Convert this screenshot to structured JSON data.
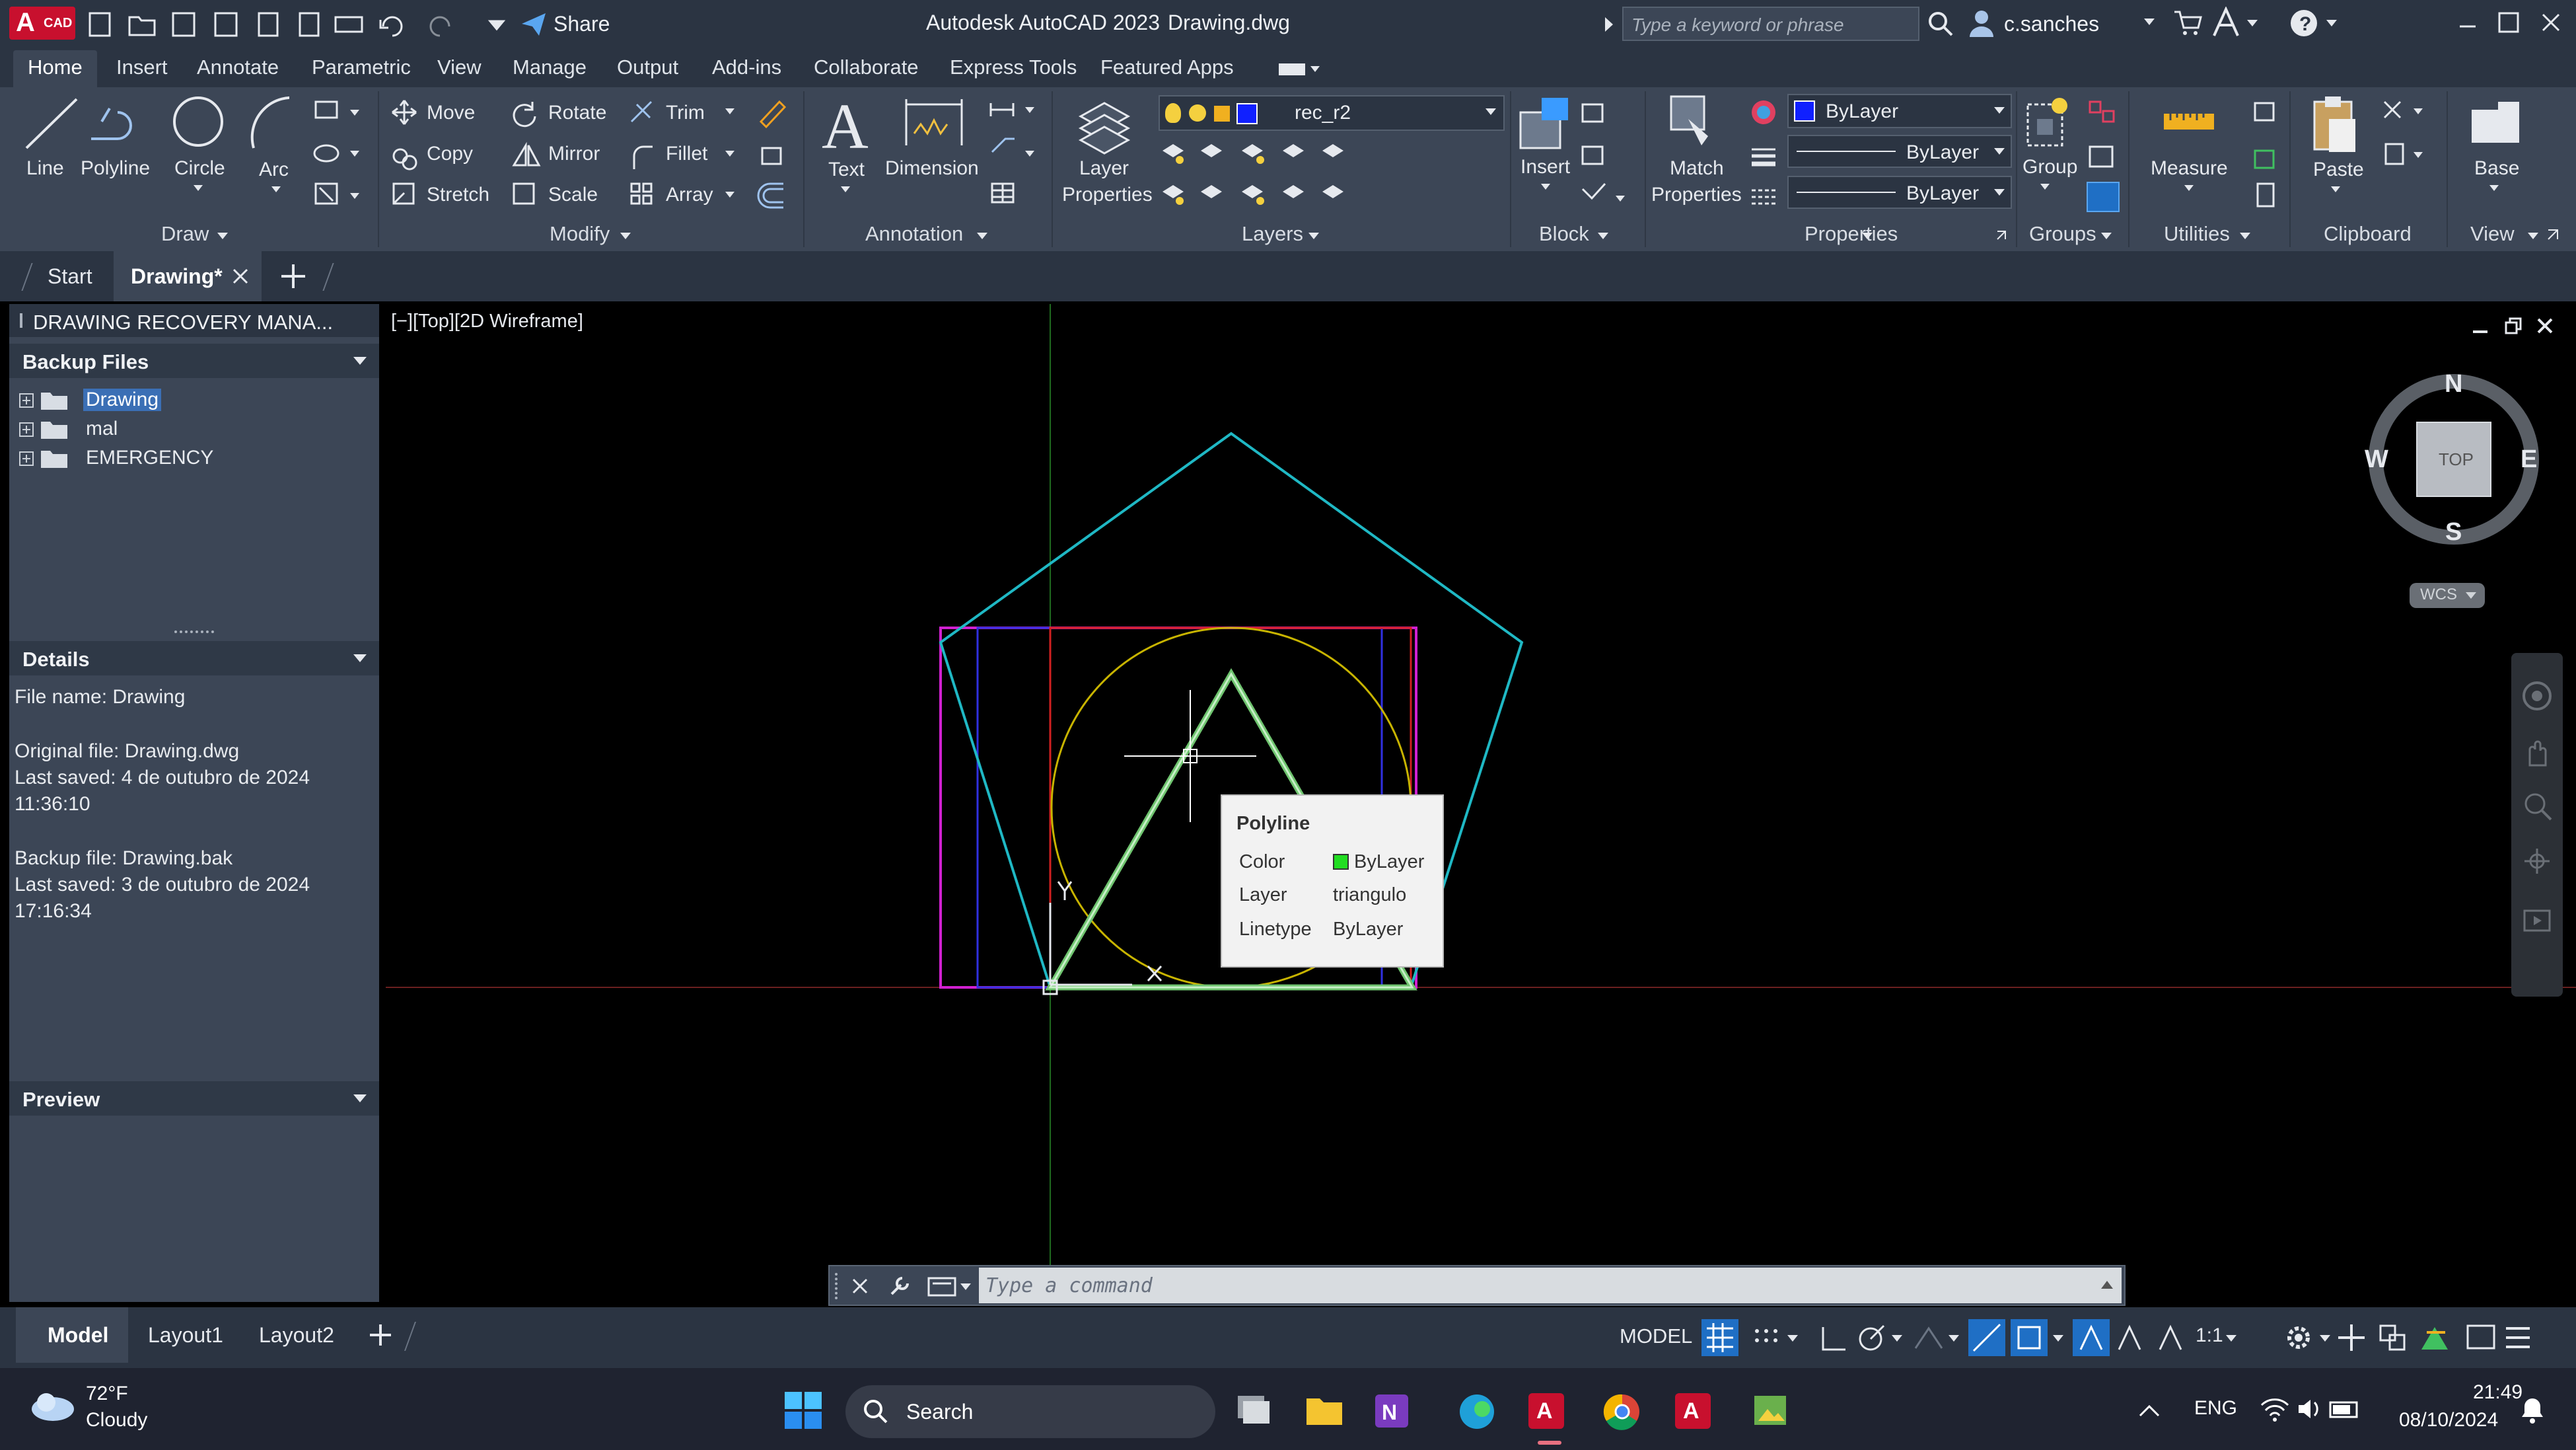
{
  "app": {
    "title": "Autodesk AutoCAD 2023",
    "file": "Drawing.dwg",
    "logo": "A",
    "logo_sub": "CAD",
    "share": "Share",
    "search_placeholder": "Type a keyword or phrase",
    "user": "c.sanches"
  },
  "ribbon_tabs": [
    "Home",
    "Insert",
    "Annotate",
    "Parametric",
    "View",
    "Manage",
    "Output",
    "Add-ins",
    "Collaborate",
    "Express Tools",
    "Featured Apps"
  ],
  "ribbon": {
    "draw": {
      "line": "Line",
      "polyline": "Polyline",
      "circle": "Circle",
      "arc": "Arc",
      "panel": "Draw"
    },
    "modify": {
      "move": "Move",
      "rotate": "Rotate",
      "trim": "Trim",
      "copy": "Copy",
      "mirror": "Mirror",
      "fillet": "Fillet",
      "stretch": "Stretch",
      "scale": "Scale",
      "array": "Array",
      "panel": "Modify"
    },
    "annotation": {
      "text": "Text",
      "dimension": "Dimension",
      "panel": "Annotation"
    },
    "layers": {
      "layer_properties_1": "Layer",
      "layer_properties_2": "Properties",
      "current_layer": "rec_r2",
      "panel": "Layers"
    },
    "block": {
      "insert": "Insert",
      "panel": "Block"
    },
    "properties": {
      "match_1": "Match",
      "match_2": "Properties",
      "color": "ByLayer",
      "linetype": "ByLayer",
      "lineweight": "ByLayer",
      "panel": "Properties"
    },
    "groups": {
      "group": "Group",
      "panel": "Groups"
    },
    "utilities": {
      "measure": "Measure",
      "panel": "Utilities"
    },
    "clipboard": {
      "paste": "Paste",
      "panel": "Clipboard"
    },
    "view": {
      "base": "Base",
      "panel": "View"
    }
  },
  "file_tabs": {
    "start": "Start",
    "drawing": "Drawing*"
  },
  "recovery": {
    "title": "DRAWING RECOVERY MANA...",
    "backup_header": "Backup Files",
    "tree": [
      "Drawing",
      "mal",
      "EMERGENCY"
    ],
    "details_header": "Details",
    "details": [
      "File name: Drawing",
      "Original file: Drawing.dwg",
      "Last saved: 4 de outubro de 2024",
      "11:36:10",
      "Backup file: Drawing.bak",
      "Last saved: 3 de outubro de 2024",
      "17:16:34"
    ],
    "preview_header": "Preview"
  },
  "viewport": {
    "label": "[−][Top][2D Wireframe]",
    "viewcube": {
      "n": "N",
      "s": "S",
      "e": "E",
      "w": "W",
      "top": "TOP",
      "wcs": "WCS"
    },
    "ucs_y": "Y",
    "ucs_x": "X"
  },
  "tooltip": {
    "title": "Polyline",
    "rows": [
      {
        "key": "Color",
        "value": "ByLayer"
      },
      {
        "key": "Layer",
        "value": "triangulo"
      },
      {
        "key": "Linetype",
        "value": "ByLayer"
      }
    ],
    "swatch_color": "#22dd22"
  },
  "command": {
    "placeholder": "Type a command"
  },
  "layout_tabs": [
    "Model",
    "Layout1",
    "Layout2"
  ],
  "status": {
    "model": "MODEL",
    "scale": "1:1"
  },
  "taskbar": {
    "temp": "72°F",
    "weather": "Cloudy",
    "search": "Search",
    "lang": "ENG",
    "time": "21:49",
    "date": "08/10/2024"
  },
  "colors": {
    "accent": "#1f6fc5",
    "pentagon": "#1fb8c4",
    "triangle": "#6fc46f",
    "circle": "#c8b400",
    "rect_magenta": "#d020d0",
    "rect_blue": "#3030e0",
    "rect_red": "#d02020"
  }
}
